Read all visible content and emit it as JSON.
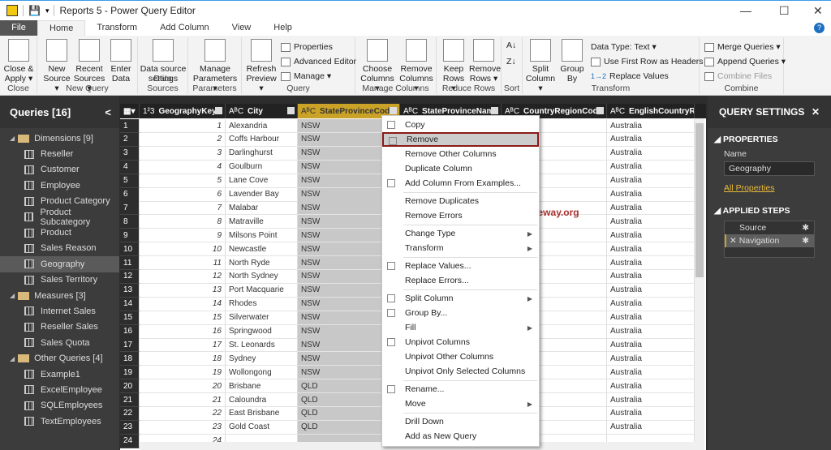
{
  "window": {
    "title": "Reports 5 - Power Query Editor",
    "minimize": "—",
    "maximize": "☐",
    "close": "✕"
  },
  "tabs": [
    "File",
    "Home",
    "Transform",
    "Add Column",
    "View",
    "Help"
  ],
  "ribbon": {
    "groups": [
      "Close",
      "New Query",
      "Data Sources",
      "Parameters",
      "Query",
      "Manage Columns",
      "Reduce Rows",
      "Sort",
      "Transform",
      "Combine"
    ],
    "close_apply": [
      "Close &",
      "Apply ▾"
    ],
    "new_source": [
      "New",
      "Source ▾"
    ],
    "recent_sources": [
      "Recent",
      "Sources ▾"
    ],
    "enter_data": [
      "Enter",
      "Data"
    ],
    "data_source_settings": [
      "Data source",
      "settings"
    ],
    "manage_parameters": [
      "Manage",
      "Parameters ▾"
    ],
    "refresh_preview": [
      "Refresh",
      "Preview ▾"
    ],
    "properties": "Properties",
    "advanced_editor": "Advanced Editor",
    "manage": "Manage ▾",
    "choose_columns": [
      "Choose",
      "Columns ▾"
    ],
    "remove_columns": [
      "Remove",
      "Columns ▾"
    ],
    "keep_rows": [
      "Keep",
      "Rows ▾"
    ],
    "remove_rows": [
      "Remove",
      "Rows ▾"
    ],
    "split_column": [
      "Split",
      "Column ▾"
    ],
    "group_by": [
      "Group",
      "By"
    ],
    "data_type": "Data Type: Text ▾",
    "use_first_row": "Use First Row as Headers ▾",
    "replace_values": "Replace Values",
    "merge_queries": "Merge Queries ▾",
    "append_queries": "Append Queries ▾",
    "combine_files": "Combine Files"
  },
  "queries": {
    "title": "Queries [16]",
    "collapse": "<",
    "items": [
      {
        "label": "Dimensions [9]",
        "type": "folder"
      },
      {
        "label": "Reseller",
        "type": "table"
      },
      {
        "label": "Customer",
        "type": "table"
      },
      {
        "label": "Employee",
        "type": "table"
      },
      {
        "label": "Product Category",
        "type": "table"
      },
      {
        "label": "Product Subcategory",
        "type": "table"
      },
      {
        "label": "Product",
        "type": "table"
      },
      {
        "label": "Sales Reason",
        "type": "table"
      },
      {
        "label": "Geography",
        "type": "table",
        "selected": true
      },
      {
        "label": "Sales Territory",
        "type": "table"
      },
      {
        "label": "Measures [3]",
        "type": "folder"
      },
      {
        "label": "Internet Sales",
        "type": "table"
      },
      {
        "label": "Reseller Sales",
        "type": "table"
      },
      {
        "label": "Sales Quota",
        "type": "table"
      },
      {
        "label": "Other Queries [4]",
        "type": "folder"
      },
      {
        "label": "Example1",
        "type": "table"
      },
      {
        "label": "ExcelEmployee",
        "type": "table"
      },
      {
        "label": "SQLEmployees",
        "type": "table"
      },
      {
        "label": "TextEmployees",
        "type": "table"
      }
    ]
  },
  "grid": {
    "columns": [
      {
        "type": "1²3",
        "name": "GeographyKey"
      },
      {
        "type": "AᴮC",
        "name": "City"
      },
      {
        "type": "AᴮC",
        "name": "StateProvinceCode",
        "selected": true
      },
      {
        "type": "AᴮC",
        "name": "StateProvinceName"
      },
      {
        "type": "AᴮC",
        "name": "CountryRegionCode"
      },
      {
        "type": "AᴮC",
        "name": "EnglishCountryRegionName"
      }
    ],
    "rows": [
      [
        1,
        "Alexandria",
        "NSW",
        "Australia"
      ],
      [
        2,
        "Coffs Harbour",
        "NSW",
        "Australia"
      ],
      [
        3,
        "Darlinghurst",
        "NSW",
        "Australia"
      ],
      [
        4,
        "Goulburn",
        "NSW",
        "Australia"
      ],
      [
        5,
        "Lane Cove",
        "NSW",
        "Australia"
      ],
      [
        6,
        "Lavender Bay",
        "NSW",
        "Australia"
      ],
      [
        7,
        "Malabar",
        "NSW",
        "Australia"
      ],
      [
        8,
        "Matraville",
        "NSW",
        "Australia"
      ],
      [
        9,
        "Milsons Point",
        "NSW",
        "Australia"
      ],
      [
        10,
        "Newcastle",
        "NSW",
        "Australia"
      ],
      [
        11,
        "North Ryde",
        "NSW",
        "Australia"
      ],
      [
        12,
        "North Sydney",
        "NSW",
        "Australia"
      ],
      [
        13,
        "Port Macquarie",
        "NSW",
        "Australia"
      ],
      [
        14,
        "Rhodes",
        "NSW",
        "Australia"
      ],
      [
        15,
        "Silverwater",
        "NSW",
        "Australia"
      ],
      [
        16,
        "Springwood",
        "NSW",
        "Australia"
      ],
      [
        17,
        "St. Leonards",
        "NSW",
        "Australia"
      ],
      [
        18,
        "Sydney",
        "NSW",
        "Australia"
      ],
      [
        19,
        "Wollongong",
        "NSW",
        "Australia"
      ],
      [
        20,
        "Brisbane",
        "QLD",
        "Australia"
      ],
      [
        21,
        "Caloundra",
        "QLD",
        "Australia"
      ],
      [
        22,
        "East Brisbane",
        "QLD",
        "Australia"
      ],
      [
        23,
        "Gold Coast",
        "QLD",
        "Australia"
      ],
      [
        24,
        "",
        "",
        ""
      ]
    ]
  },
  "context_menu": [
    {
      "label": "Copy",
      "icon": true
    },
    {
      "label": "Remove",
      "icon": true,
      "highlight": true
    },
    {
      "label": "Remove Other Columns"
    },
    {
      "label": "Duplicate Column"
    },
    {
      "label": "Add Column From Examples...",
      "icon": true
    },
    {
      "sep": true
    },
    {
      "label": "Remove Duplicates"
    },
    {
      "label": "Remove Errors"
    },
    {
      "sep": true
    },
    {
      "label": "Change Type",
      "sub": true
    },
    {
      "label": "Transform",
      "sub": true
    },
    {
      "sep": true
    },
    {
      "label": "Replace Values...",
      "icon": true
    },
    {
      "label": "Replace Errors..."
    },
    {
      "sep": true
    },
    {
      "label": "Split Column",
      "sub": true,
      "icon": true
    },
    {
      "label": "Group By...",
      "icon": true
    },
    {
      "label": "Fill",
      "sub": true
    },
    {
      "label": "Unpivot Columns",
      "icon": true
    },
    {
      "label": "Unpivot Other Columns"
    },
    {
      "label": "Unpivot Only Selected Columns"
    },
    {
      "sep": true
    },
    {
      "label": "Rename...",
      "icon": true
    },
    {
      "label": "Move",
      "sub": true
    },
    {
      "sep": true
    },
    {
      "label": "Drill Down"
    },
    {
      "label": "Add as New Query"
    }
  ],
  "watermark": "©tutorialgateway.org",
  "settings": {
    "title": "QUERY SETTINGS",
    "close": "✕",
    "properties": "PROPERTIES",
    "name_label": "Name",
    "name_value": "Geography",
    "all_properties": "All Properties",
    "applied_steps": "APPLIED STEPS",
    "steps": [
      "Source",
      "✕ Navigation"
    ],
    "gear": "✱"
  }
}
